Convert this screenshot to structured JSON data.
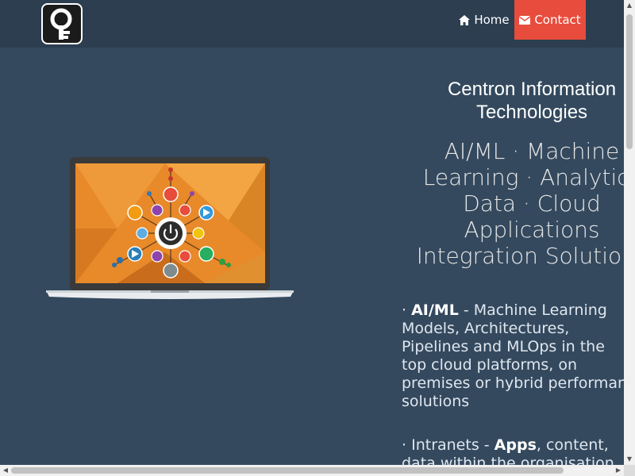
{
  "nav": {
    "logo_icon": "key-logo-icon",
    "home_label": "Home",
    "home_icon": "home-icon",
    "contact_label": "Contact",
    "contact_icon": "envelope-icon"
  },
  "colors": {
    "navbar": "#2c3e50",
    "background": "#34495e",
    "contact_accent": "#e74c3c",
    "screen_orange": "#e8892a"
  },
  "hero": {
    "company_name_line1": "Centron Information",
    "company_name_line2": "Technologies",
    "tagline_lines": [
      "AI/ML · Machine",
      "Learning · Analytics",
      "Data · Cloud",
      "Applications",
      "Integration Solutions"
    ]
  },
  "features": [
    {
      "bullet": "·",
      "title": "AI/ML",
      "lines": [
        " - Machine Learning",
        "Models, Architectures,",
        "Pipelines and MLOps in the",
        "top cloud platforms, on",
        "premises or hybrid performant",
        "solutions"
      ]
    },
    {
      "bullet": "·",
      "prefix": "Intranets - ",
      "title": "Apps",
      "lines": [
        ", content,",
        "data within the organisation"
      ]
    }
  ]
}
